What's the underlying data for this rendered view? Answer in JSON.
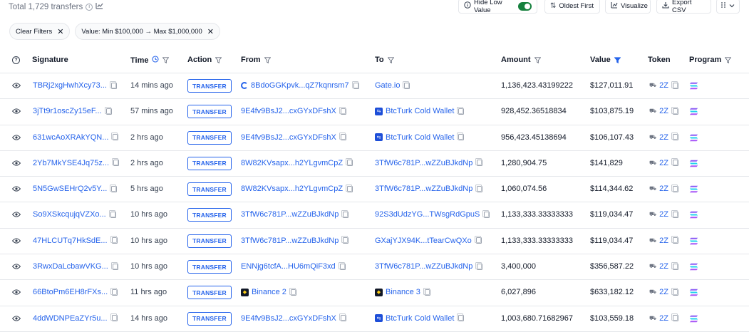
{
  "toolbar": {
    "total_label": "Total 1,729 transfers",
    "hide_low_value": "Hide Low Value",
    "oldest_first": "Oldest First",
    "visualize": "Visualize",
    "export_csv": "Export CSV"
  },
  "filters": {
    "clear": "Clear Filters",
    "value_filter": "Value: Min $100,000 → Max $1,000,000"
  },
  "columns": {
    "signature": "Signature",
    "time": "Time",
    "action": "Action",
    "from": "From",
    "to": "To",
    "amount": "Amount",
    "value": "Value",
    "token": "Token",
    "program": "Program"
  },
  "colors": {
    "accent": "#2563eb",
    "toggle_on": "#15803d",
    "binance": "#facc15"
  },
  "rows": [
    {
      "signature": "TBRj2xgHwhXcy73...",
      "time": "14 mins ago",
      "action": "TRANSFER",
      "from": "8BdoGGKpvk...qZ7kqnrsm7",
      "from_icon": "gate",
      "to": "Gate.io",
      "to_icon": "none",
      "amount": "1,136,423.43199222",
      "value": "$127,011.91",
      "token": "2Z"
    },
    {
      "signature": "3jTt9r1oscZy15eF...",
      "time": "57 mins ago",
      "action": "TRANSFER",
      "from": "9E4fv9BsJ2...cxGYxDFshX",
      "from_icon": "none",
      "to": "BtcTurk Cold Wallet",
      "to_icon": "btc",
      "amount": "928,452.36518834",
      "value": "$103,875.19",
      "token": "2Z"
    },
    {
      "signature": "631wcAoXRAkYQN...",
      "time": "2 hrs ago",
      "action": "TRANSFER",
      "from": "9E4fv9BsJ2...cxGYxDFshX",
      "from_icon": "none",
      "to": "BtcTurk Cold Wallet",
      "to_icon": "btc",
      "amount": "956,423.45138694",
      "value": "$106,107.43",
      "token": "2Z"
    },
    {
      "signature": "2Yb7MkYSE4Jq75z...",
      "time": "2 hrs ago",
      "action": "TRANSFER",
      "from": "8W82KVsapx...h2YLgvmCpZ",
      "from_icon": "none",
      "to": "3TfW6c781P...wZZuBJkdNp",
      "to_icon": "none",
      "amount": "1,280,904.75",
      "value": "$141,829",
      "token": "2Z"
    },
    {
      "signature": "5N5GwSEHrQ2v5Y...",
      "time": "5 hrs ago",
      "action": "TRANSFER",
      "from": "8W82KVsapx...h2YLgvmCpZ",
      "from_icon": "none",
      "to": "3TfW6c781P...wZZuBJkdNp",
      "to_icon": "none",
      "amount": "1,060,074.56",
      "value": "$114,344.62",
      "token": "2Z"
    },
    {
      "signature": "So9XSkcqujqVZXo...",
      "time": "10 hrs ago",
      "action": "TRANSFER",
      "from": "3TfW6c781P...wZZuBJkdNp",
      "from_icon": "none",
      "to": "92S3dUdzYG...TWsgRdGpuS",
      "to_icon": "none",
      "amount": "1,133,333.33333333",
      "value": "$119,034.47",
      "token": "2Z"
    },
    {
      "signature": "47HLCUTq7HkSdE...",
      "time": "10 hrs ago",
      "action": "TRANSFER",
      "from": "3TfW6c781P...wZZuBJkdNp",
      "from_icon": "none",
      "to": "GXajYJX94K...tTearCwQXo",
      "to_icon": "none",
      "amount": "1,133,333.33333333",
      "value": "$119,034.47",
      "token": "2Z"
    },
    {
      "signature": "3RwxDaLcbawVKG...",
      "time": "10 hrs ago",
      "action": "TRANSFER",
      "from": "ENNjg6tcfA...HU6mQiF3xd",
      "from_icon": "none",
      "to": "3TfW6c781P...wZZuBJkdNp",
      "to_icon": "none",
      "amount": "3,400,000",
      "value": "$356,587.22",
      "token": "2Z"
    },
    {
      "signature": "66BtoPm6EH8rFXs...",
      "time": "11 hrs ago",
      "action": "TRANSFER",
      "from": "Binance 2",
      "from_icon": "bnb",
      "to": "Binance 3",
      "to_icon": "bnb",
      "amount": "6,027,896",
      "value": "$633,182.12",
      "token": "2Z"
    },
    {
      "signature": "4ddWDNPEaZYr5u...",
      "time": "14 hrs ago",
      "action": "TRANSFER",
      "from": "9E4fv9BsJ2...cxGYxDFshX",
      "from_icon": "none",
      "to": "BtcTurk Cold Wallet",
      "to_icon": "btc",
      "amount": "1,003,680.71682967",
      "value": "$103,559.18",
      "token": "2Z"
    }
  ]
}
